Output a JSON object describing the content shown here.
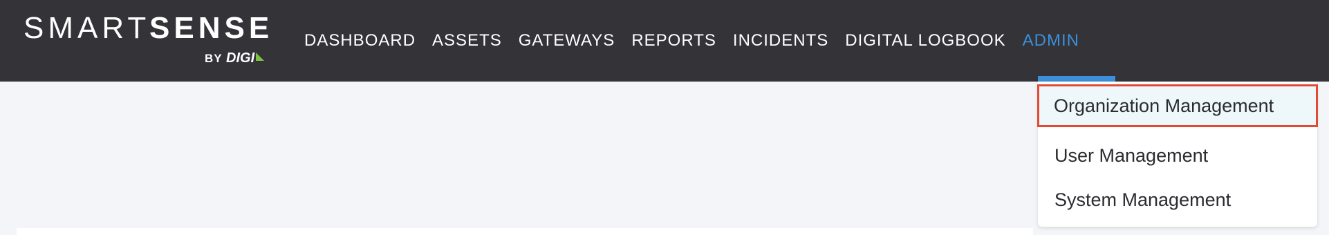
{
  "logo": {
    "smart": "SMART",
    "sense": "SENSE",
    "by": "BY",
    "digi": "DIGI"
  },
  "nav": {
    "items": [
      {
        "label": "DASHBOARD"
      },
      {
        "label": "ASSETS"
      },
      {
        "label": "GATEWAYS"
      },
      {
        "label": "REPORTS"
      },
      {
        "label": "INCIDENTS"
      },
      {
        "label": "DIGITAL LOGBOOK"
      },
      {
        "label": "ADMIN"
      }
    ],
    "active": "ADMIN"
  },
  "admin_menu": {
    "items": [
      {
        "label": "Organization Management"
      },
      {
        "label": "User Management"
      },
      {
        "label": "System Management"
      }
    ],
    "highlighted": "Organization Management"
  },
  "colors": {
    "topbar_bg": "#333338",
    "accent": "#3d8fd9",
    "highlight_border": "#e24a33",
    "logo_tick": "#7cc242",
    "page_bg": "#f3f5f8"
  }
}
